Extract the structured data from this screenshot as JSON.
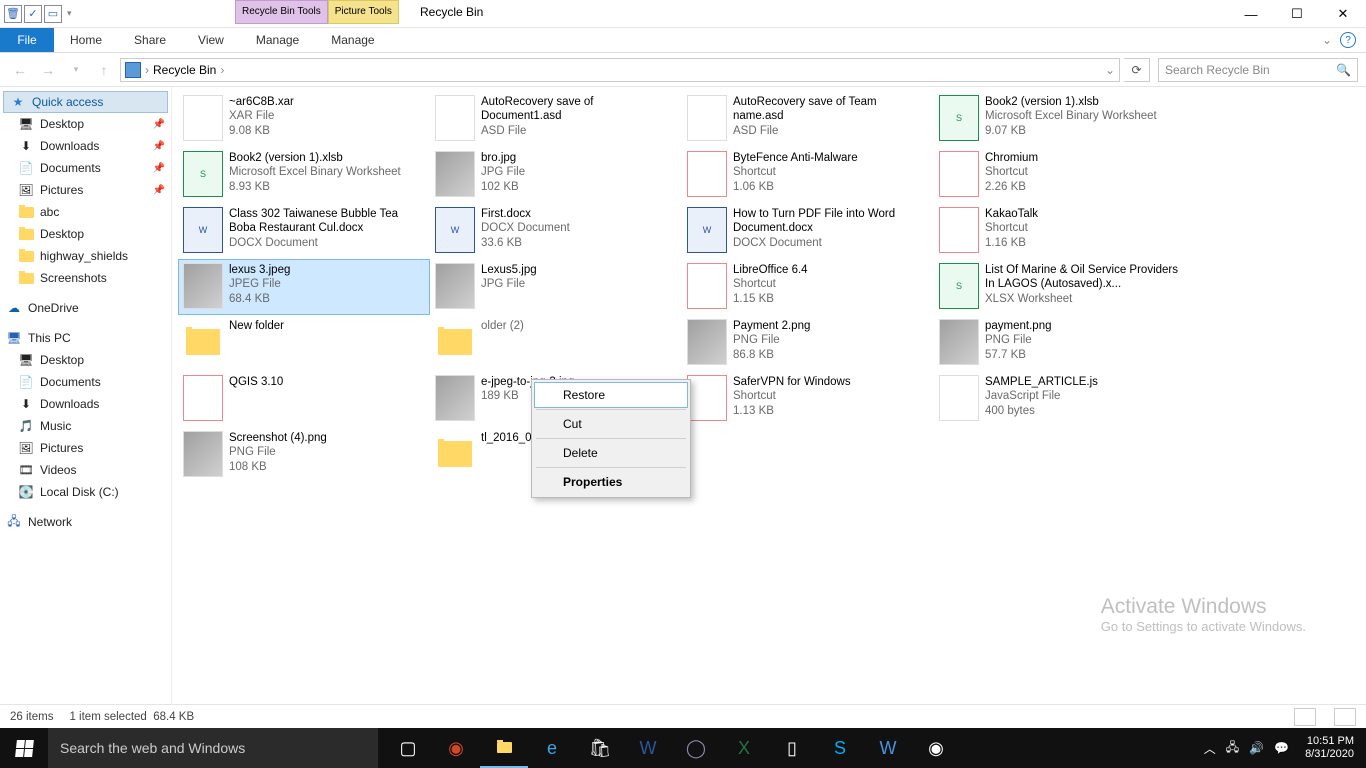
{
  "title": "Recycle Bin",
  "tabtools": {
    "recycle": "Recycle Bin Tools",
    "picture": "Picture Tools"
  },
  "ribbon": {
    "file": "File",
    "tabs": [
      "Home",
      "Share",
      "View",
      "Manage",
      "Manage"
    ]
  },
  "nav": {
    "crumb": "Recycle Bin",
    "search_placeholder": "Search Recycle Bin"
  },
  "sidebar": {
    "quick_access": "Quick access",
    "qa_items": [
      {
        "label": "Desktop",
        "icon": "desktop",
        "pin": true
      },
      {
        "label": "Downloads",
        "icon": "downloads",
        "pin": true
      },
      {
        "label": "Documents",
        "icon": "documents",
        "pin": true
      },
      {
        "label": "Pictures",
        "icon": "pictures",
        "pin": true
      },
      {
        "label": "abc",
        "icon": "folder",
        "pin": false
      },
      {
        "label": "Desktop",
        "icon": "folder",
        "pin": false
      },
      {
        "label": "highway_shields",
        "icon": "folder",
        "pin": false
      },
      {
        "label": "Screenshots",
        "icon": "folder",
        "pin": false
      }
    ],
    "onedrive": "OneDrive",
    "thispc": "This PC",
    "pc_items": [
      {
        "label": "Desktop",
        "icon": "desktop"
      },
      {
        "label": "Documents",
        "icon": "documents"
      },
      {
        "label": "Downloads",
        "icon": "downloads"
      },
      {
        "label": "Music",
        "icon": "music"
      },
      {
        "label": "Pictures",
        "icon": "pictures"
      },
      {
        "label": "Videos",
        "icon": "videos"
      },
      {
        "label": "Local Disk (C:)",
        "icon": "disk"
      }
    ],
    "network": "Network"
  },
  "files": [
    {
      "name": "~ar6C8B.xar",
      "type": "XAR File",
      "size": "9.08 KB",
      "thumb": "file"
    },
    {
      "name": "AutoRecovery save of Document1.asd",
      "type": "ASD File",
      "size": "",
      "thumb": "file",
      "two": 1
    },
    {
      "name": "AutoRecovery save of Team name.asd",
      "type": "ASD File",
      "size": "",
      "thumb": "file",
      "two": 1
    },
    {
      "name": "Book2 (version 1).xlsb",
      "type": "Microsoft Excel Binary Worksheet",
      "size": "9.07 KB",
      "thumb": "xls"
    },
    {
      "name": "Book2 (version 1).xlsb",
      "type": "Microsoft Excel Binary Worksheet",
      "size": "8.93 KB",
      "thumb": "xls"
    },
    {
      "name": "bro.jpg",
      "type": "JPG File",
      "size": "102 KB",
      "thumb": "img"
    },
    {
      "name": "ByteFence Anti-Malware",
      "type": "Shortcut",
      "size": "1.06 KB",
      "thumb": "sc"
    },
    {
      "name": "Chromium",
      "type": "Shortcut",
      "size": "2.26 KB",
      "thumb": "sc"
    },
    {
      "name": "Class 302 Taiwanese Bubble Tea Boba Restaurant Cul.docx",
      "type": "DOCX Document",
      "size": "",
      "thumb": "doc",
      "two": 1
    },
    {
      "name": "First.docx",
      "type": "DOCX Document",
      "size": "33.6 KB",
      "thumb": "doc"
    },
    {
      "name": "How to Turn PDF File into Word Document.docx",
      "type": "DOCX Document",
      "size": "",
      "thumb": "doc",
      "two": 1
    },
    {
      "name": "KakaoTalk",
      "type": "Shortcut",
      "size": "1.16 KB",
      "thumb": "sc"
    },
    {
      "name": "lexus 3.jpeg",
      "type": "JPEG File",
      "size": "68.4 KB",
      "thumb": "img",
      "selected": 1
    },
    {
      "name": "Lexus5.jpg",
      "type": "JPG File",
      "size": "",
      "thumb": "img"
    },
    {
      "name": "LibreOffice 6.4",
      "type": "Shortcut",
      "size": "1.15 KB",
      "thumb": "sc"
    },
    {
      "name": "List Of Marine & Oil Service Providers In LAGOS (Autosaved).x...",
      "type": "XLSX Worksheet",
      "size": "",
      "thumb": "xls",
      "two": 1
    },
    {
      "name": "New folder",
      "type": "",
      "size": "",
      "thumb": "fold"
    },
    {
      "name": "",
      "type": "older (2)",
      "size": "",
      "thumb": "fold"
    },
    {
      "name": "Payment 2.png",
      "type": "PNG File",
      "size": "86.8 KB",
      "thumb": "img"
    },
    {
      "name": "payment.png",
      "type": "PNG File",
      "size": "57.7 KB",
      "thumb": "img"
    },
    {
      "name": "QGIS 3.10",
      "type": "",
      "size": "",
      "thumb": "sc"
    },
    {
      "name": "e-jpeg-to-jpg-3.jpg",
      "type": "",
      "size": "189 KB",
      "thumb": "img"
    },
    {
      "name": "SaferVPN for Windows",
      "type": "Shortcut",
      "size": "1.13 KB",
      "thumb": "sc"
    },
    {
      "name": "SAMPLE_ARTICLE.js",
      "type": "JavaScript File",
      "size": "400 bytes",
      "thumb": "file"
    },
    {
      "name": "Screenshot (4).png",
      "type": "PNG File",
      "size": "108 KB",
      "thumb": "img"
    },
    {
      "name": "tl_2016_06_tract.zip",
      "type": "",
      "size": "",
      "thumb": "fold"
    }
  ],
  "context_menu": [
    "Restore",
    "Cut",
    "Delete",
    "Properties"
  ],
  "status": {
    "count": "26 items",
    "sel": "1 item selected",
    "size": "68.4 KB"
  },
  "watermark": {
    "t1": "Activate Windows",
    "t2": "Go to Settings to activate Windows."
  },
  "taskbar_search": "Search the web and Windows",
  "clock": {
    "time": "10:51 PM",
    "date": "8/31/2020"
  }
}
